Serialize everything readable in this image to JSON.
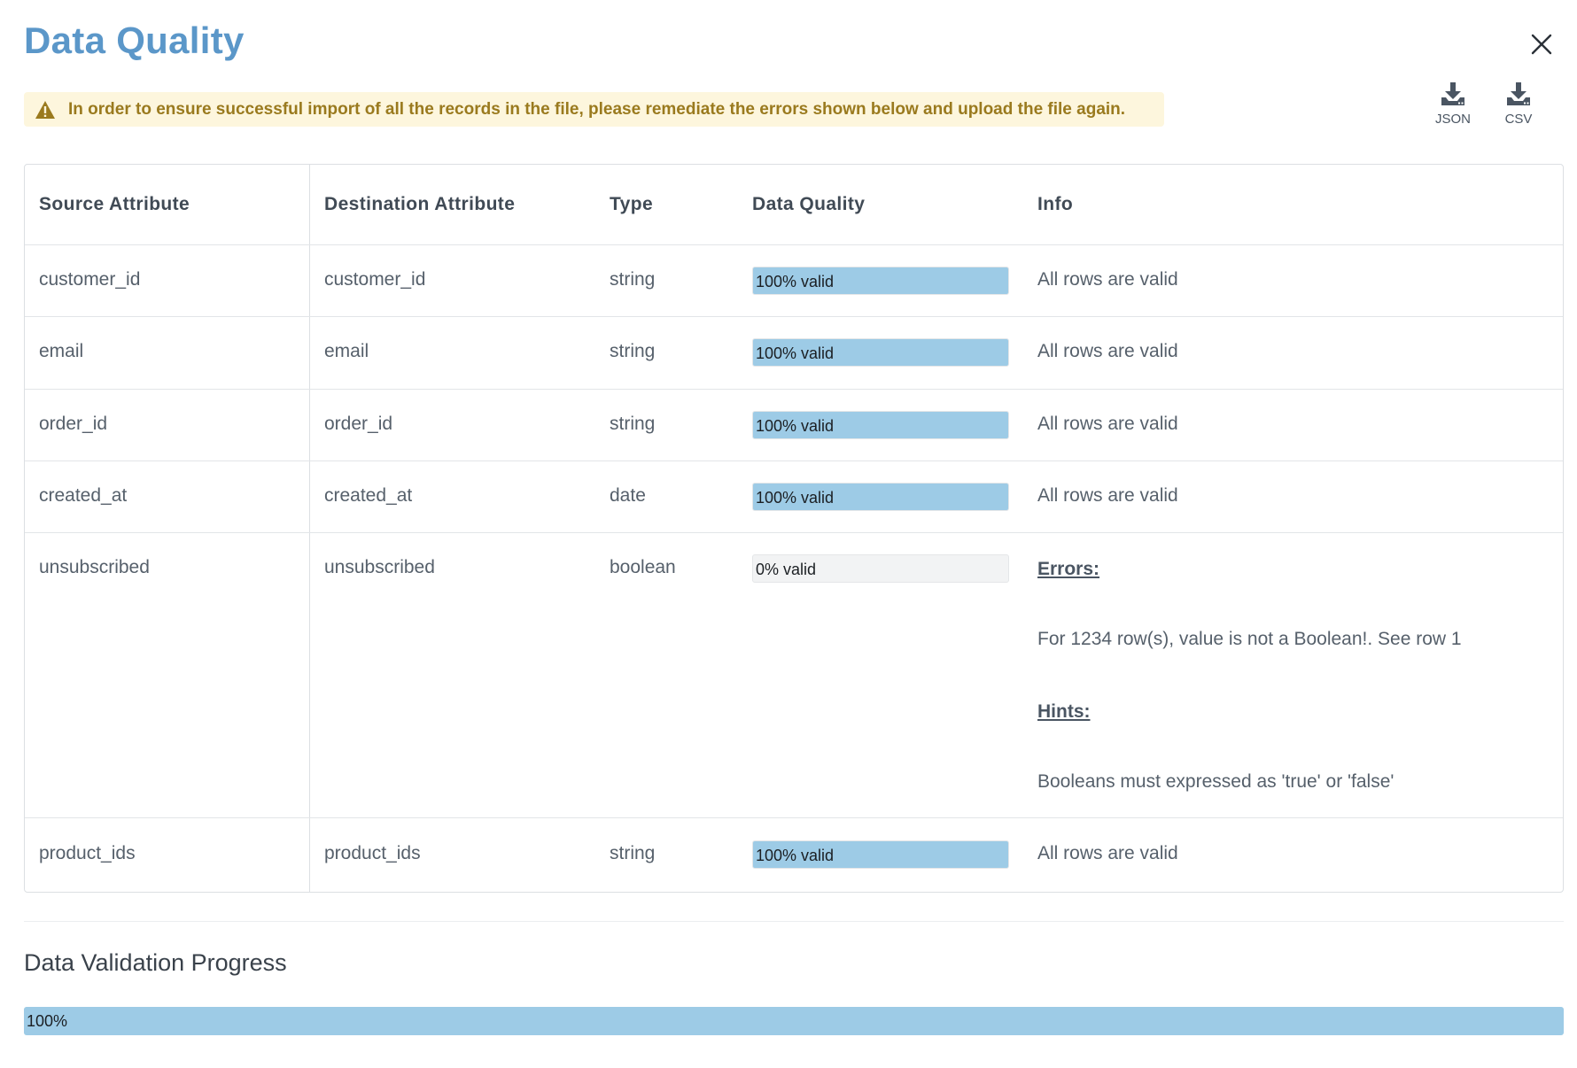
{
  "modal": {
    "title": "Data Quality"
  },
  "warning": {
    "icon": "warning-icon",
    "message": "In order to ensure successful import of all the records in the file, please remediate the errors shown below and upload the file again."
  },
  "downloads": [
    {
      "icon": "download-icon",
      "label": "JSON"
    },
    {
      "icon": "download-icon",
      "label": "CSV"
    }
  ],
  "colors": {
    "accent": "#5b97c9",
    "bar_fill": "#9dcbe6",
    "warning_bg": "#fdf6dd",
    "warning_text": "#9a7a1e"
  },
  "table": {
    "headers": [
      "Source Attribute",
      "Destination Attribute",
      "Type",
      "Data Quality",
      "Info"
    ],
    "rows": [
      {
        "source": "customer_id",
        "destination": "customer_id",
        "type": "string",
        "quality_pct": 100,
        "quality_label": "100% valid",
        "info": "All rows are valid"
      },
      {
        "source": "email",
        "destination": "email",
        "type": "string",
        "quality_pct": 100,
        "quality_label": "100% valid",
        "info": "All rows are valid"
      },
      {
        "source": "order_id",
        "destination": "order_id",
        "type": "string",
        "quality_pct": 100,
        "quality_label": "100% valid",
        "info": "All rows are valid"
      },
      {
        "source": "created_at",
        "destination": "created_at",
        "type": "date",
        "quality_pct": 100,
        "quality_label": "100% valid",
        "info": "All rows are valid"
      },
      {
        "source": "unsubscribed",
        "destination": "unsubscribed",
        "type": "boolean",
        "quality_pct": 0,
        "quality_label": "0% valid",
        "errors_heading": "Errors:",
        "error_text": "For 1234 row(s), value is not a Boolean!. See row 1",
        "hints_heading": "Hints:",
        "hint_text": "Booleans must expressed as 'true' or 'false'"
      },
      {
        "source": "product_ids",
        "destination": "product_ids",
        "type": "string",
        "quality_pct": 100,
        "quality_label": "100% valid",
        "info": "All rows are valid"
      }
    ]
  },
  "progress": {
    "title": "Data Validation Progress",
    "percent": 100,
    "label": "100%"
  }
}
